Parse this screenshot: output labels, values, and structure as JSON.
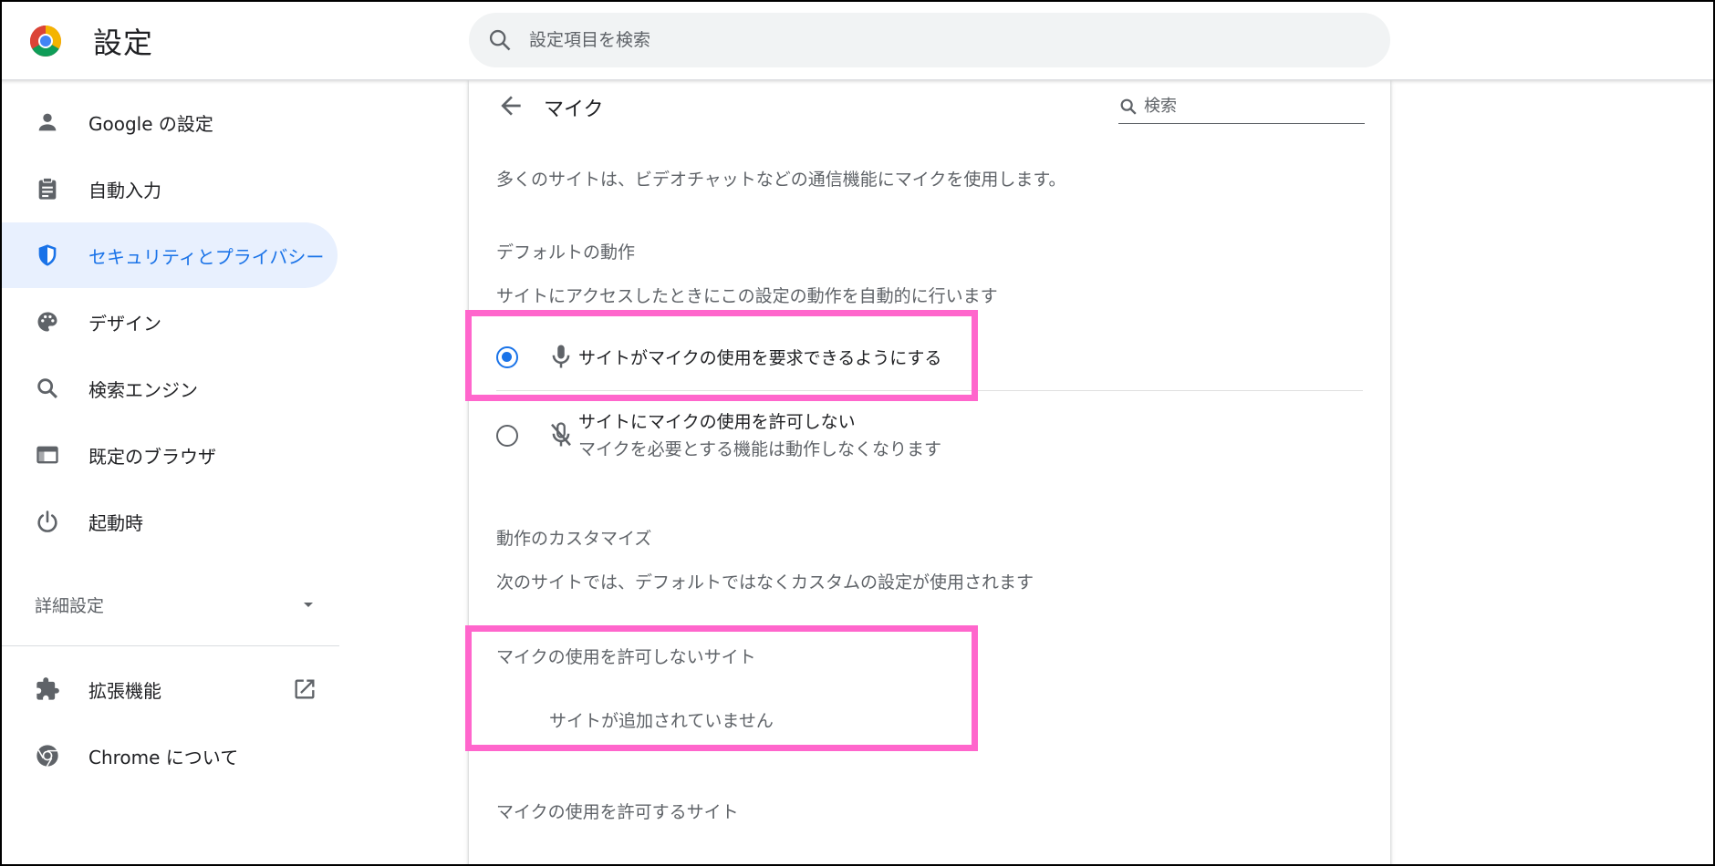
{
  "header": {
    "title": "設定",
    "search_placeholder": "設定項目を検索"
  },
  "sidebar": {
    "items": [
      {
        "label": "Google の設定",
        "icon": "person-icon"
      },
      {
        "label": "自動入力",
        "icon": "clipboard-icon"
      },
      {
        "label": "セキュリティとプライバシー",
        "icon": "shield-icon",
        "active": true
      },
      {
        "label": "デザイン",
        "icon": "palette-icon"
      },
      {
        "label": "検索エンジン",
        "icon": "search-icon"
      },
      {
        "label": "既定のブラウザ",
        "icon": "browser-window-icon"
      },
      {
        "label": "起動時",
        "icon": "power-icon"
      }
    ],
    "advanced_label": "詳細設定",
    "extensions_label": "拡張機能",
    "about_label": "Chrome について"
  },
  "main": {
    "title": "マイク",
    "search_placeholder": "検索",
    "description": "多くのサイトは、ビデオチャットなどの通信機能にマイクを使用します。",
    "default_behavior": {
      "heading": "デフォルトの動作",
      "subheading": "サイトにアクセスしたときにこの設定の動作を自動的に行います",
      "options": [
        {
          "label": "サイトがマイクの使用を要求できるようにする",
          "selected": true,
          "icon": "mic-icon"
        },
        {
          "label": "サイトにマイクの使用を許可しない",
          "sublabel": "マイクを必要とする機能は動作しなくなります",
          "selected": false,
          "icon": "mic-off-icon"
        }
      ]
    },
    "customize": {
      "heading": "動作のカスタマイズ",
      "subheading": "次のサイトでは、デフォルトではなくカスタムの設定が使用されます"
    },
    "blocked_sites": {
      "heading": "マイクの使用を許可しないサイト",
      "empty_text": "サイトが追加されていません"
    },
    "allowed_sites": {
      "heading": "マイクの使用を許可するサイト"
    }
  },
  "colors": {
    "accent": "#1a73e8",
    "active_bg": "#e8f0fe",
    "highlight": "#ff66cc"
  }
}
